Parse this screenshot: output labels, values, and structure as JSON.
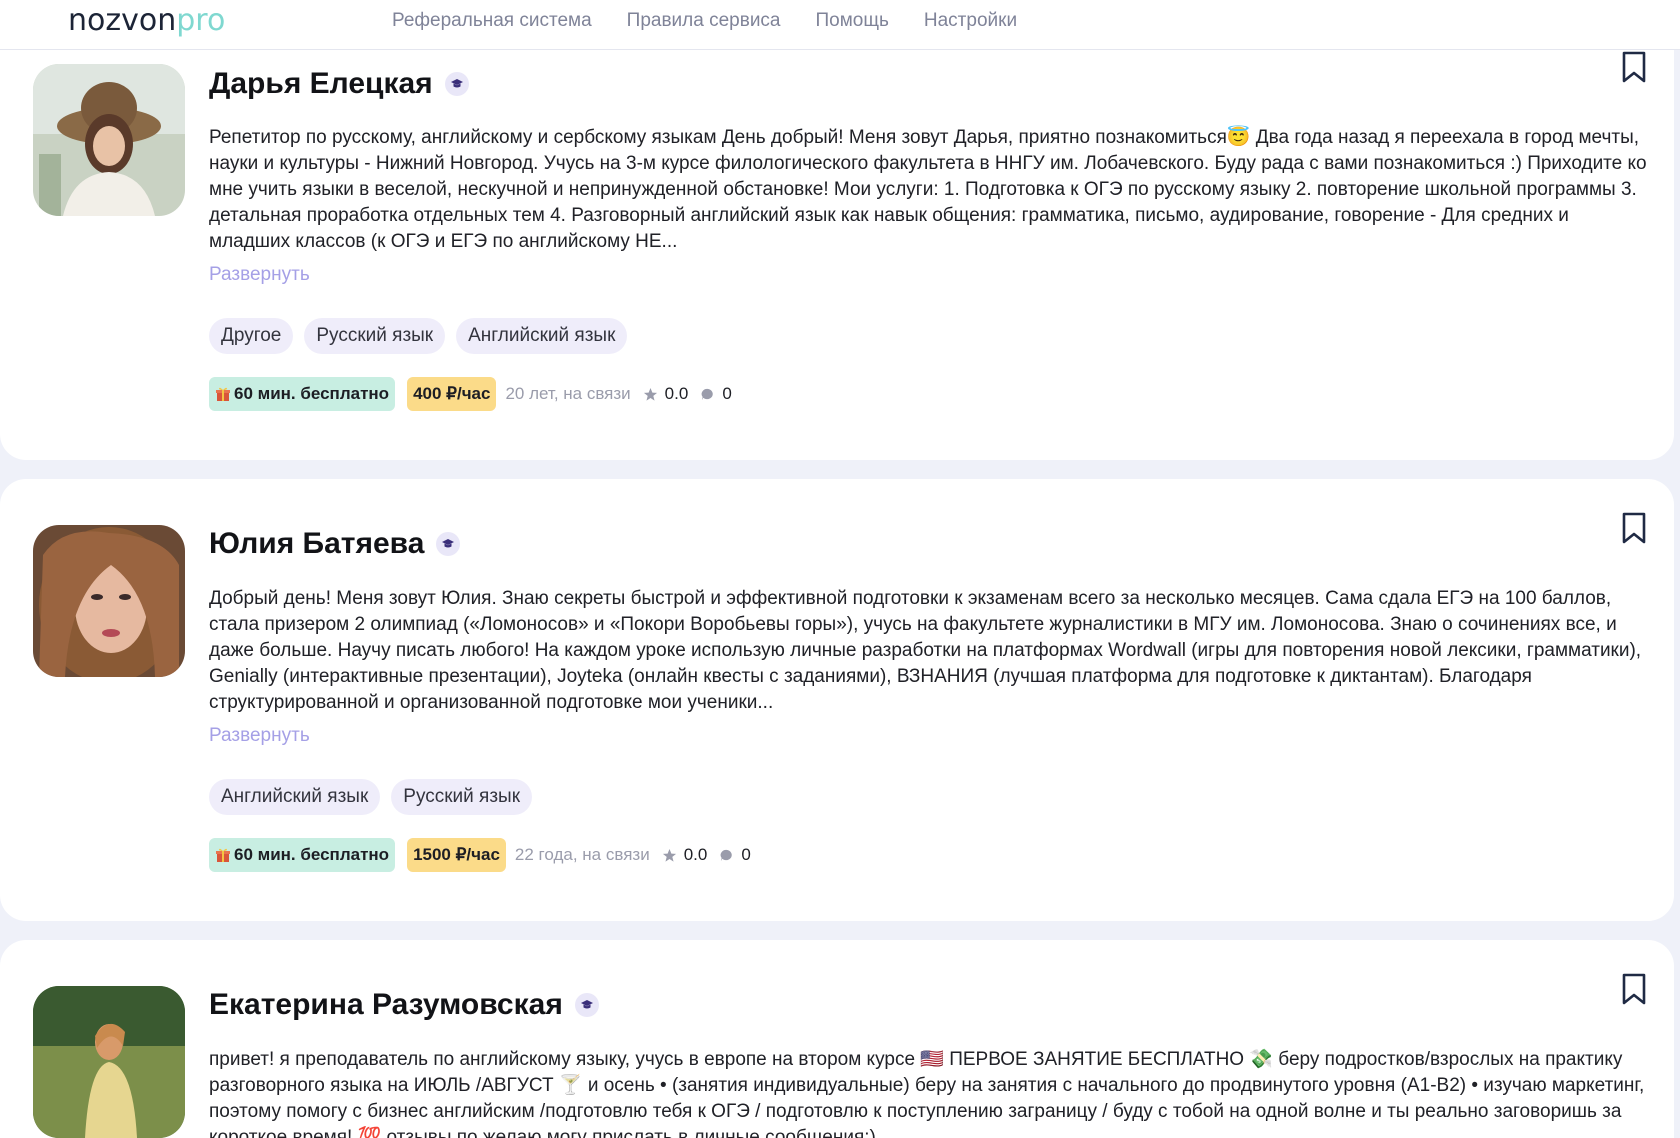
{
  "header": {
    "logo_part1": "nozvon",
    "logo_part2": "pro",
    "nav": [
      "Реферальная система",
      "Правила сервиса",
      "Помощь",
      "Настройки"
    ]
  },
  "colors": {
    "accent": "#a5a0e6",
    "free_badge": "#c8eee2",
    "price_badge": "#fbdb89",
    "tag_bg": "#efedfa"
  },
  "tutors": [
    {
      "name": "Дарья Елецкая",
      "description": "Репетитор по русскому, английскому и сербскому языкам День добрый! Меня зовут Дарья, приятно познакомиться😇 Два года назад я переехала в город мечты, науки и культуры - Нижний Новгород. Учусь на 3-м курсе филологического факультета в ННГУ им. Лобачевского. Буду рада с вами познакомиться :) Приходите ко мне учить языки в веселой, нескучной и непринужденной обстановке! Мои услуги: 1. Подготовка к ОГЭ по русскому языку 2. повторение школьной программы 3. детальная проработка отдельных тем 4. Разговорный английский язык как навык общения: грамматика, письмо, аудирование, говорение - Для средних и младших классов (к ОГЭ и ЕГЭ по английскому НЕ...",
      "expand_label": "Развернуть",
      "tags": [
        "Другое",
        "Русский язык",
        "Английский язык"
      ],
      "free_trial": "60 мин. бесплатно",
      "price": "400 ₽/час",
      "age_status": "20 лет, на связи",
      "rating": "0.0",
      "reviews": "0"
    },
    {
      "name": "Юлия Батяева",
      "description": "Добрый день! Меня зовут Юлия. Знаю секреты быстрой и эффективной подготовки к экзаменам всего за несколько месяцев. Сама сдала ЕГЭ на 100 баллов, стала призером 2 олимпиад («Ломоносов» и «Покори Воробьевы горы»), учусь на факультете журналистики в МГУ им. Ломоносова. Знаю о сочинениях все, и даже больше. Научу писать любого! На каждом уроке использую личные разработки на платформах Wordwall (игры для повторения новой лексики, грамматики), Genially (интерактивные презентации), Joyteka (онлайн квесты с заданиями), ВЗНАНИЯ (лучшая платформа для подготовке к диктантам). Благодаря структурированной и организованной подготовке мои ученики...",
      "expand_label": "Развернуть",
      "tags": [
        "Английский язык",
        "Русский язык"
      ],
      "free_trial": "60 мин. бесплатно",
      "price": "1500 ₽/час",
      "age_status": "22 года, на связи",
      "rating": "0.0",
      "reviews": "0"
    },
    {
      "name": "Екатерина Разумовская",
      "description": "привет! я преподаватель по английскому языку, учусь в европе на втором курсе 🇺🇸 ПЕРВОЕ ЗАНЯТИЕ БЕСПЛАТНО 💸 беру подростков/взрослых на практику разговорного языка на ИЮЛЬ /АВГУСТ 🍸 и осень • (занятия индивидуальные) беру на занятия с начального до продвинутого уровня (A1-B2) • изучаю маркетинг, поэтому помогу с бизнес английским /подготовлю тебя к ОГЭ / подготовлю к поступлению заграницу / буду с тобой на одной волне и ты реально заговоришь за короткое время! 💯 отзывы по желаю могу прислать в личные сообщения:)"
    }
  ]
}
